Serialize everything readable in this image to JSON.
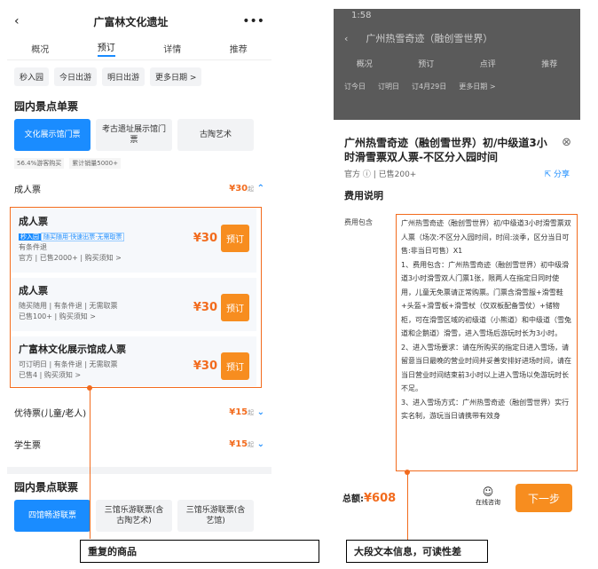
{
  "left": {
    "title": "广富林文化遗址",
    "tabs": [
      "概况",
      "预订",
      "详情",
      "推荐"
    ],
    "chips": [
      "秒入园",
      "今日出游",
      "明日出游",
      "更多日期 >"
    ],
    "sec1": "园内景点单票",
    "ticket_tabs": [
      "文化展示馆门票",
      "考古遗址展示馆门票",
      "古陶艺术"
    ],
    "meta": [
      "56.4%游客购买",
      "累计销量5000+"
    ],
    "adult": "成人票",
    "adult_price": "¥30",
    "qi": "起",
    "cards": [
      {
        "name": "成人票",
        "tags": [
          "秒入园",
          "随买随用·快速出票·无需取票"
        ],
        "l2": "有条件退",
        "l3": "官方 | 已售2000+ | 购买须知 >",
        "price": "¥30",
        "btn": "预订"
      },
      {
        "name": "成人票",
        "l2": "随买随用 | 有条件退 | 无需取票",
        "l3": "已售100+ | 购买须知 >",
        "price": "¥30",
        "btn": "预订"
      },
      {
        "name": "广富林文化展示馆成人票",
        "l2": "可订明日 | 有条件退 | 无需取票",
        "l3": "已售4 | 购买须知 >",
        "price": "¥30",
        "btn": "预订"
      }
    ],
    "youdai": "优待票(儿童/老人)",
    "youdai_price": "¥15",
    "student": "学生票",
    "student_price": "¥15",
    "sec2": "园内景点联票",
    "combo": [
      "四馆畅游联票",
      "三馆乐游联票(含古陶艺术)",
      "三馆乐游联票(含艺馆)"
    ]
  },
  "right": {
    "status_time": "1:58",
    "bg_title": "广州热雪奇迹（融创雪世界）",
    "bg_tabs": [
      "概况",
      "预订",
      "点评",
      "推荐"
    ],
    "bg_dates": [
      "订今日",
      "订明日",
      "订4月29日",
      "更多日期 >"
    ],
    "sheet_title": "广州热雪奇迹（融创雪世界）初/中级道3小时滑雪票双人票-不区分入园时间",
    "sheet_sub": "官方 ⓘ | 已售200+",
    "share": "分享",
    "fee_head": "费用说明",
    "fee_label": "费用包含",
    "fee_text": "广州热雪奇迹（融创雪世界）初/中级道3小时滑雪票双人票（场次:不区分入园时间，时间:淡季，区分当日可售:非当日可售）X1\n1、费用包含：广州热雪奇迹（融创雪世界）初中级滑道3小时滑雪双人门票1张，限两人在指定日同时使用，儿童无免票请正常购票。门票含滑雪服+滑雪鞋+头盔+滑雪板+滑雪杖（仅双板配备雪仗）+储物柜，可在滑雪区域的初级道（小熊道）和中级道（雪兔道和企鹅道）滑雪，进入雪场后游玩时长为3小时。\n2、进入雪场要求：请在所购买的指定日进入雪场，请留意当日最晚的营业时间并妥善安排好进场时间，请在当日营业时间结束前3小时以上进入雪场以免游玩时长不足。\n3、进入雪场方式：广州热雪奇迹（融创雪世界）实行实名制，游玩当日请携带有效身",
    "total_label": "总额:",
    "total": "¥608",
    "consult": "在线咨询",
    "next": "下一步"
  },
  "callouts": {
    "left": "重复的商品",
    "right": "大段文本信息，可读性差"
  },
  "colors": {
    "accent": "#1a8cff",
    "orange": "#f78d1f",
    "callout_red": "#f26b1d"
  }
}
